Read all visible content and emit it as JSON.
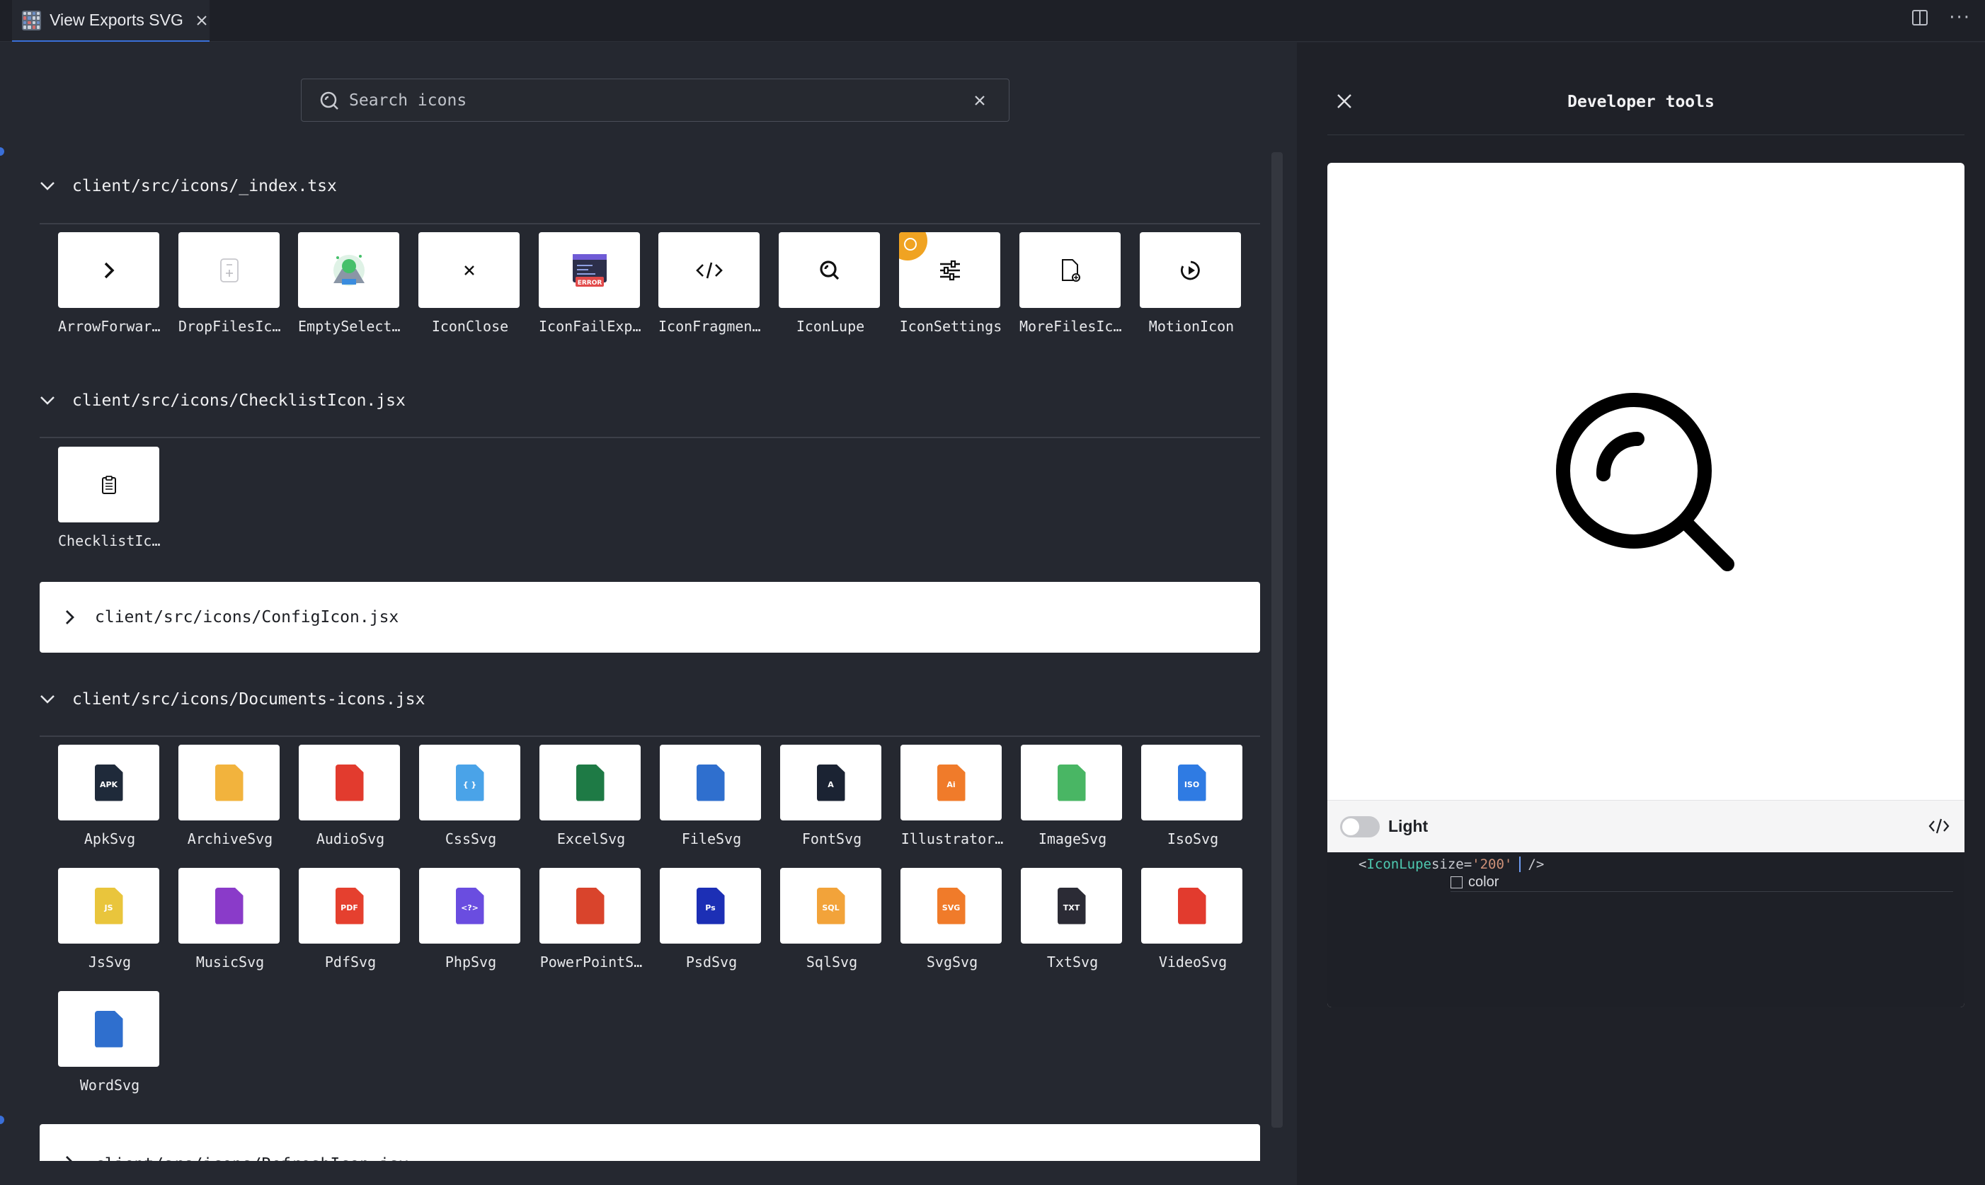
{
  "tab": {
    "title": "View Exports SVG"
  },
  "search": {
    "placeholder": "Search icons",
    "value": ""
  },
  "groups": {
    "index": {
      "path": "client/src/icons/_index.tsx",
      "tiles": [
        "ArrowForwar…",
        "DropFilesIc…",
        "EmptySelect…",
        "IconClose",
        "IconFailExp…",
        "IconFragmen…",
        "IconLupe",
        "IconSettings",
        "MoreFilesIc…",
        "MotionIcon"
      ]
    },
    "checklist": {
      "path": "client/src/icons/ChecklistIcon.jsx",
      "tiles": [
        "ChecklistIc…"
      ]
    },
    "config": {
      "path": "client/src/icons/ConfigIcon.jsx"
    },
    "documents": {
      "path": "client/src/icons/Documents-icons.jsx",
      "tiles": [
        "ApkSvg",
        "ArchiveSvg",
        "AudioSvg",
        "CssSvg",
        "ExcelSvg",
        "FileSvg",
        "FontSvg",
        "Illustrator…",
        "ImageSvg",
        "IsoSvg",
        "JsSvg",
        "MusicSvg",
        "PdfSvg",
        "PhpSvg",
        "PowerPointS…",
        "PsdSvg",
        "SqlSvg",
        "SvgSvg",
        "TxtSvg",
        "VideoSvg",
        "WordSvg"
      ],
      "badges": [
        "APK",
        "",
        "",
        "{ }",
        "",
        "",
        "A",
        "Ai",
        "",
        "ISO",
        "JS",
        "",
        "PDF",
        "<?>",
        "",
        "Ps",
        "SQL",
        "SVG",
        "TXT",
        "",
        ""
      ],
      "colors": [
        "#1f2a3a",
        "#f2b33d",
        "#e23b2e",
        "#4aa3e8",
        "#1e7a45",
        "#2f6fce",
        "#1b2333",
        "#f07b2a",
        "#49b664",
        "#2f7be3",
        "#e9c53c",
        "#8a3bc9",
        "#e5402f",
        "#6a4de0",
        "#d9442c",
        "#1c2fb5",
        "#f2a33a",
        "#f07b2a",
        "#2b2b35",
        "#e23b2e",
        "#2f6fce"
      ]
    },
    "refresh": {
      "path": "client/src/icons/RefreshIcon.jsx"
    }
  },
  "devtools": {
    "title": "Developer tools",
    "theme_label": "Light",
    "code": {
      "open": "<",
      "component": "IconLupe",
      "prop": " size=",
      "value": "'200'",
      "close": "/>"
    },
    "prop_option": "color"
  }
}
